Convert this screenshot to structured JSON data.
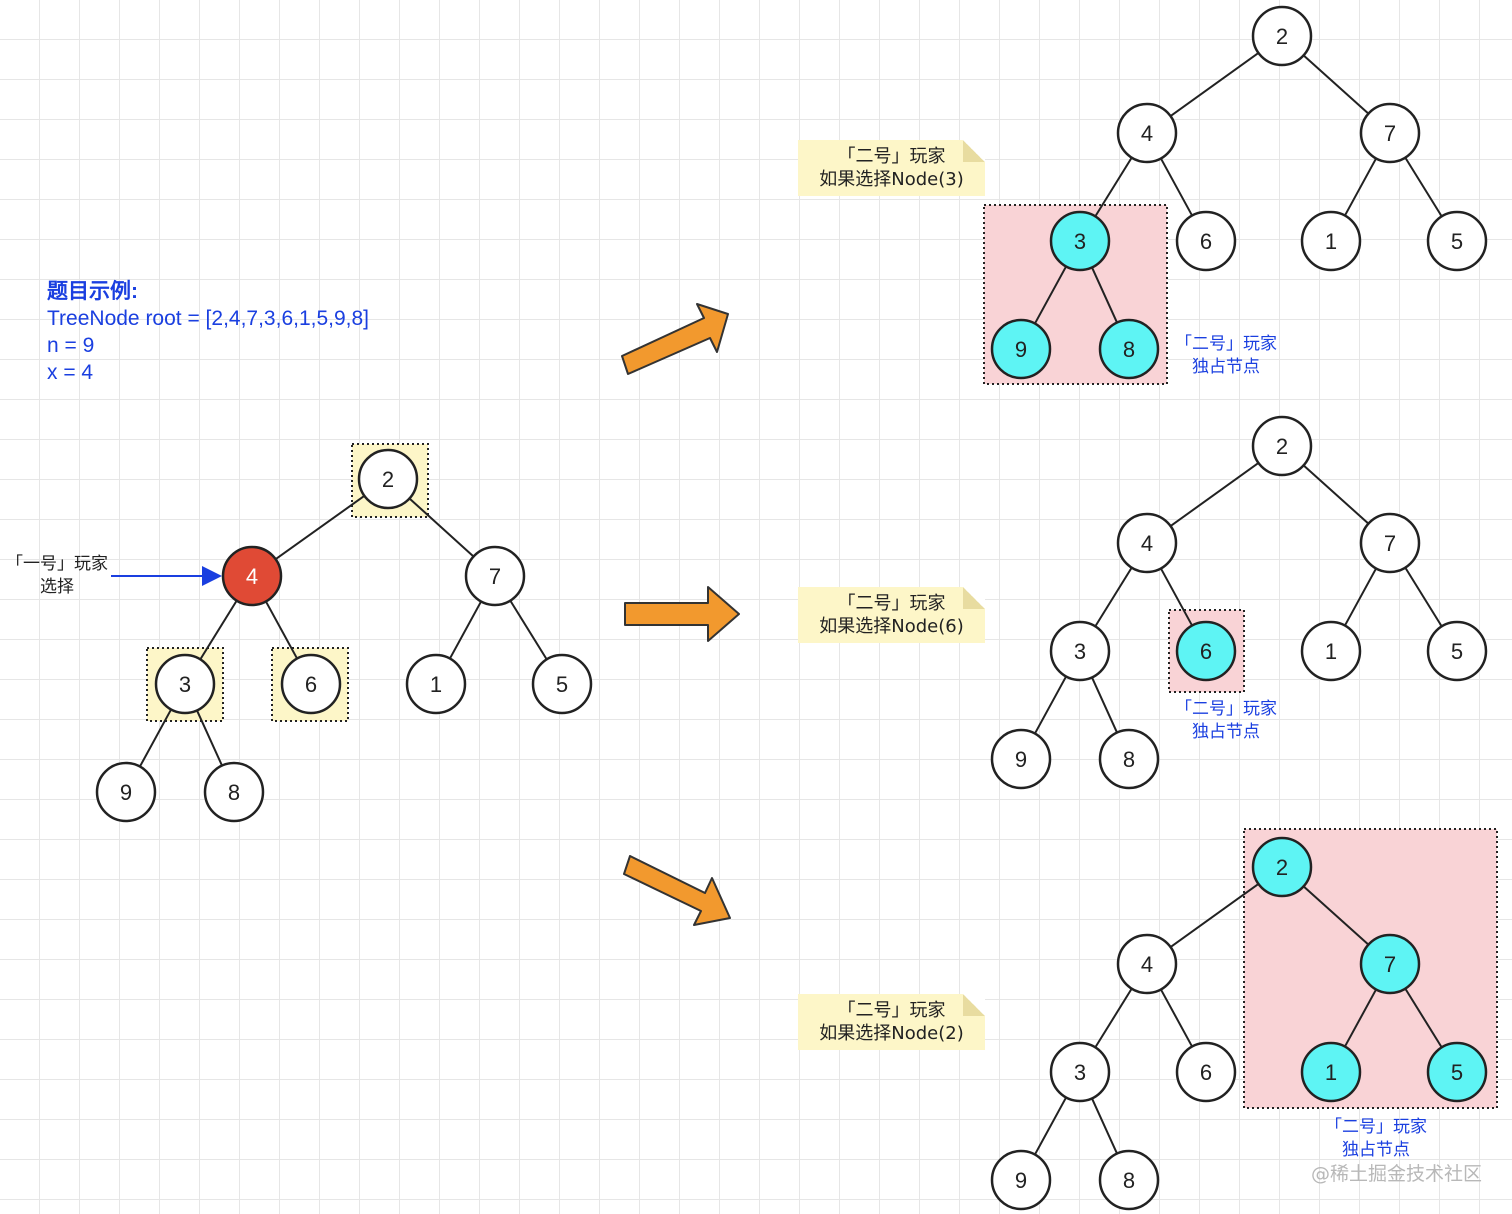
{
  "example": {
    "heading": "题目示例:",
    "line1": "TreeNode root = [2,4,7,3,6,1,5,9,8]",
    "line2": "n = 9",
    "line3": "x = 4"
  },
  "player1_label": [
    "「一号」玩家",
    "选择"
  ],
  "scenarios": [
    {
      "note_line1": "「二号」玩家",
      "note_line2": "如果选择Node(3)",
      "owned_line1": "「二号」玩家",
      "owned_line2": "独占节点"
    },
    {
      "note_line1": "「二号」玩家",
      "note_line2": "如果选择Node(6)",
      "owned_line1": "「二号」玩家",
      "owned_line2": "独占节点"
    },
    {
      "note_line1": "「二号」玩家",
      "note_line2": "如果选择Node(2)",
      "owned_line1": "「二号」玩家",
      "owned_line2": "独占节点"
    }
  ],
  "tree": {
    "nodes": [
      "2",
      "4",
      "7",
      "3",
      "6",
      "1",
      "5",
      "9",
      "8"
    ],
    "edges": [
      [
        0,
        1
      ],
      [
        0,
        2
      ],
      [
        1,
        3
      ],
      [
        1,
        4
      ],
      [
        2,
        5
      ],
      [
        2,
        6
      ],
      [
        3,
        7
      ],
      [
        3,
        8
      ]
    ]
  },
  "colors": {
    "player1": "#e04a35",
    "player2": "#5ef4f4",
    "highlight_yellow": "#fdf6c8",
    "region_pink": "#f9d3d6",
    "arrow_orange": "#f2992e",
    "text_blue": "#1a3fe0"
  },
  "watermark": "@稀土掘金技术社区"
}
